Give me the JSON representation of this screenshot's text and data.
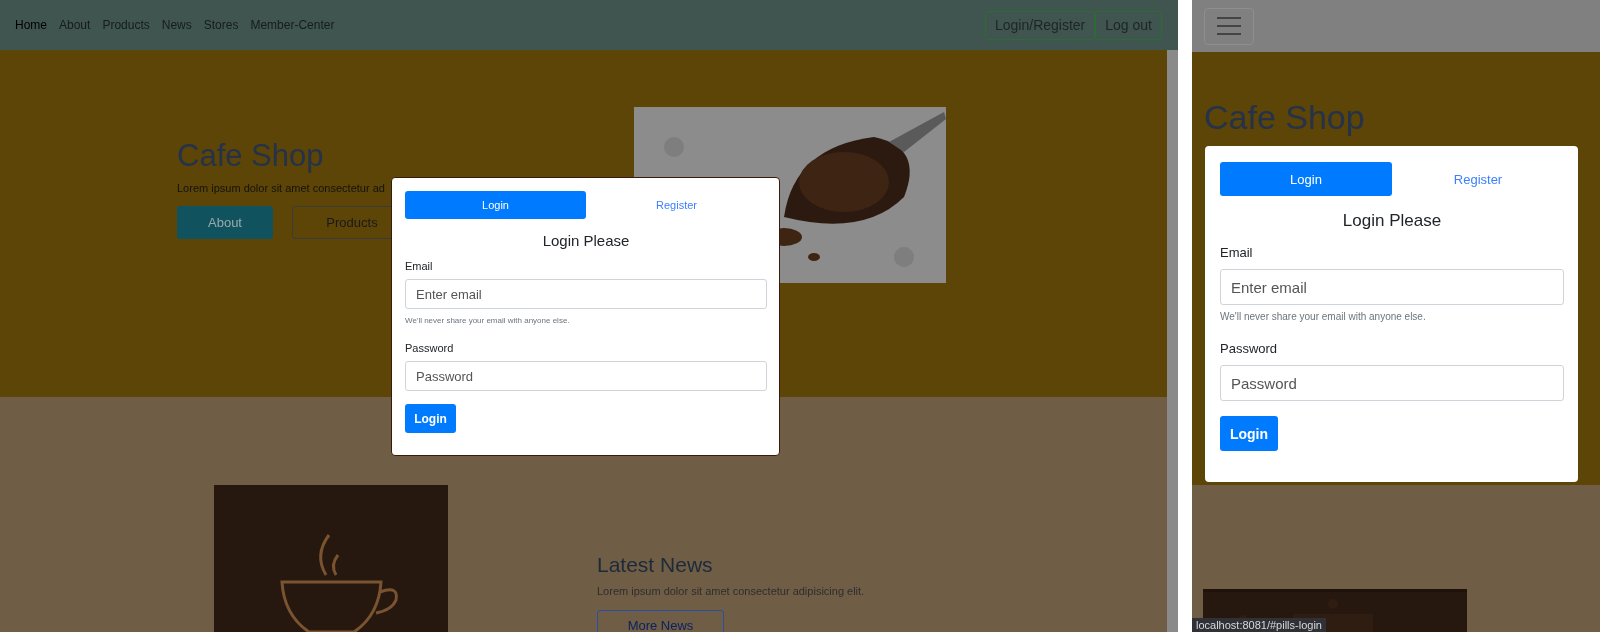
{
  "left": {
    "nav": {
      "links": [
        {
          "label": "Home",
          "selected": true
        },
        {
          "label": "About",
          "selected": false
        },
        {
          "label": "Products",
          "selected": false
        },
        {
          "label": "News",
          "selected": false
        },
        {
          "label": "Stores",
          "selected": false
        },
        {
          "label": "Member-Center",
          "selected": false
        }
      ],
      "buttons": [
        "Login/Register",
        "Log out"
      ]
    },
    "hero": {
      "title": "Cafe Shop",
      "text": "Lorem ipsum dolor sit amet consectetur ad",
      "buttons": [
        {
          "label": "About",
          "kind": "solid"
        },
        {
          "label": "Products",
          "kind": "outline"
        }
      ]
    },
    "news": {
      "title": "Latest News",
      "text": "Lorem ipsum dolor sit amet consectetur adipisicing elit.",
      "button": "More News"
    }
  },
  "right": {
    "hero": {
      "title": "Cafe Shop"
    },
    "status_url": "localhost:8081/#pills-login"
  },
  "modals": [
    {
      "tabs": [
        {
          "label": "Login",
          "selected": true
        },
        {
          "label": "Register",
          "selected": false
        }
      ],
      "heading": "Login Please",
      "email": {
        "label": "Email",
        "placeholder": "Enter email",
        "help": "We'll never share your email with anyone else."
      },
      "password": {
        "label": "Password",
        "placeholder": "Password"
      },
      "submit": "Login"
    },
    {
      "tabs": [
        {
          "label": "Login",
          "selected": true
        },
        {
          "label": "Register",
          "selected": false
        }
      ],
      "heading": "Login Please",
      "email": {
        "label": "Email",
        "placeholder": "Enter email",
        "help": "We'll never share your email with anyone else."
      },
      "password": {
        "label": "Password",
        "placeholder": "Password"
      },
      "submit": "Login"
    }
  ]
}
